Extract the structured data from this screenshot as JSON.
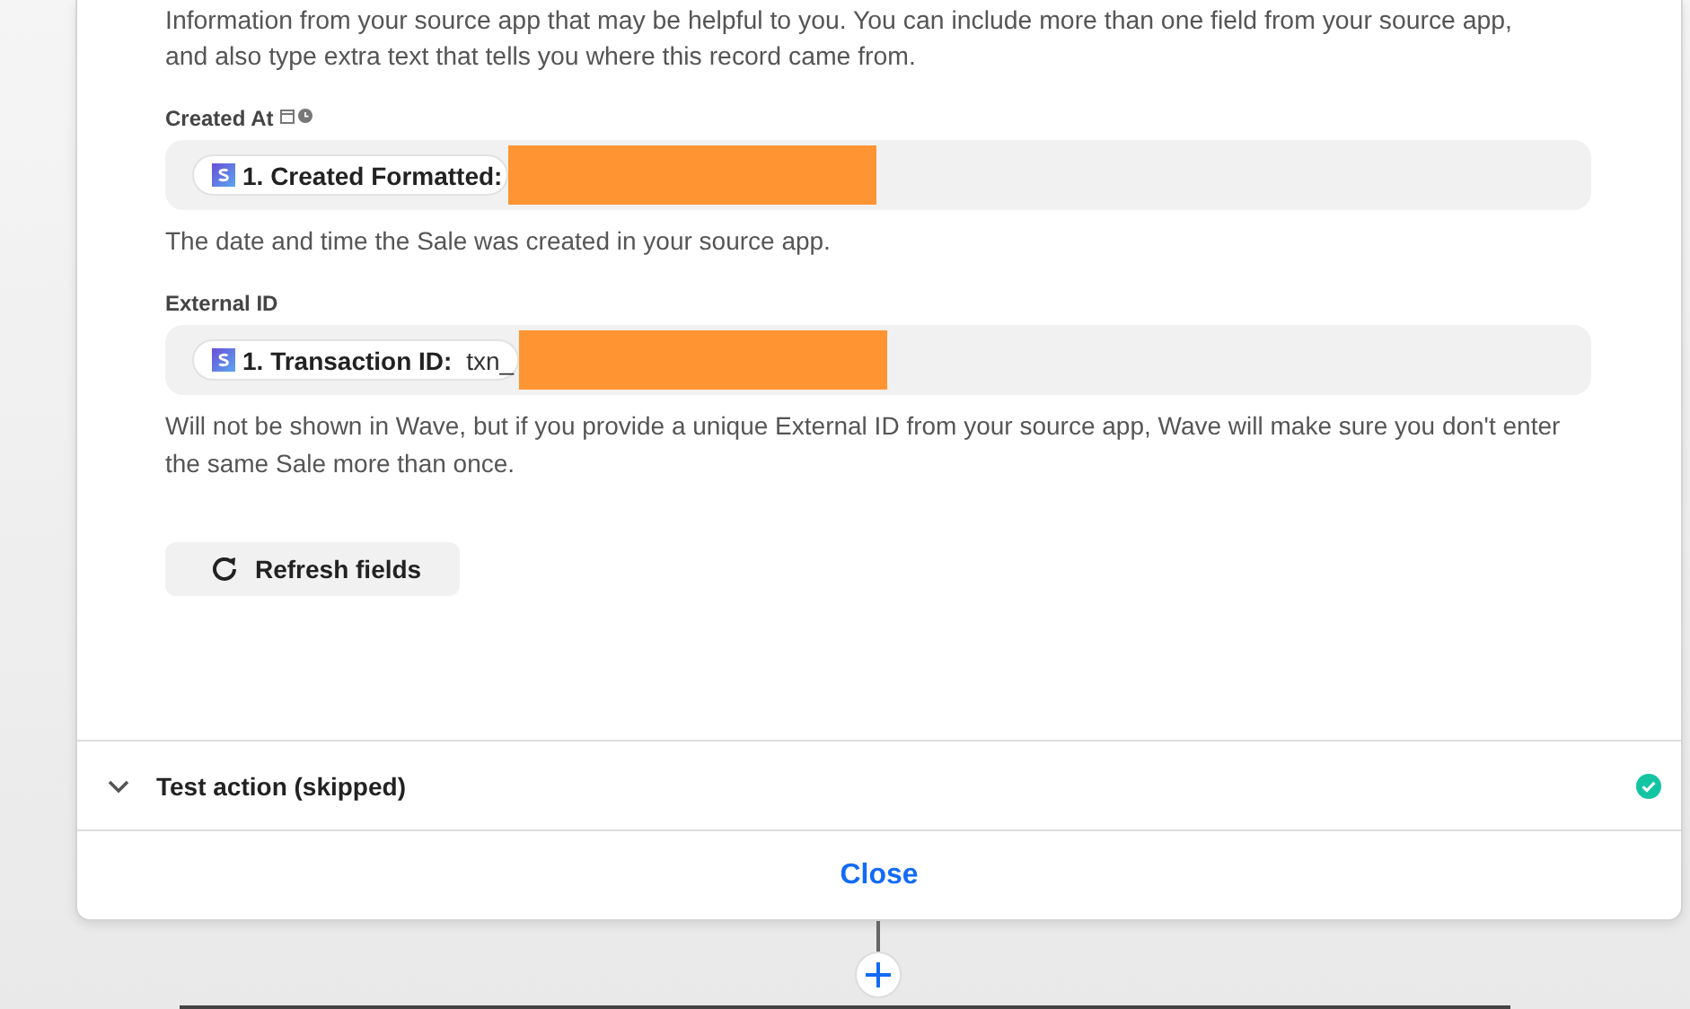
{
  "intro": [
    "Information from your source app that may be helpful to you. You can include more than one field from your source app,",
    "and also type extra text that tells you where this record came from."
  ],
  "fields": [
    {
      "label": "Created At",
      "date_time_icons": true,
      "pill": {
        "label": "1. Created Formatted:"
      },
      "redacted": true,
      "help": "The date and time the Sale was created in your source app."
    },
    {
      "label": "External ID",
      "date_time_icons": false,
      "pill": {
        "label": "1. Transaction ID:",
        "value": "txn_"
      },
      "redacted": true,
      "help": "Will not be shown in Wave, but if you provide a unique External ID from your source app, Wave will make sure you don't enter the same Sale more than once."
    }
  ],
  "refresh_button": "Refresh fields",
  "test_section": {
    "title": "Test action (skipped)",
    "expanded": false,
    "complete": true
  },
  "close_button": "Close"
}
